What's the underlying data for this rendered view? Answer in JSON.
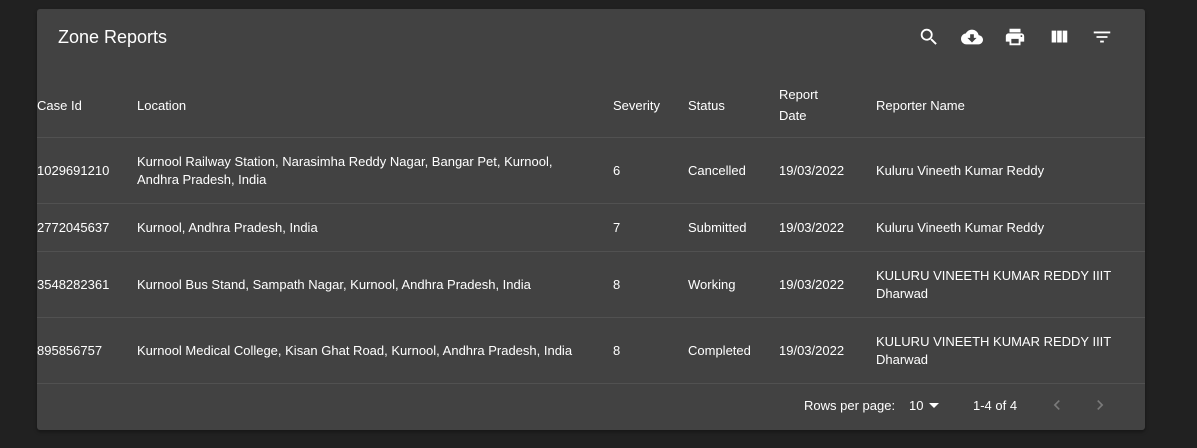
{
  "title": "Zone Reports",
  "toolbar": {
    "icons": [
      "search-icon",
      "cloud-download-icon",
      "print-icon",
      "view-column-icon",
      "filter-list-icon"
    ]
  },
  "columns": {
    "case_id": "Case Id",
    "location": "Location",
    "severity": "Severity",
    "status": "Status",
    "report_date_line1": "Report",
    "report_date_line2": "Date",
    "reporter": "Reporter Name"
  },
  "rows": [
    {
      "case_id": "1029691210",
      "location_line1": "Kurnool Railway Station, Narasimha Reddy Nagar, Bangar Pet, Kurnool,",
      "location_line2": "Andhra Pradesh, India",
      "severity": "6",
      "status": "Cancelled",
      "date": "19/03/2022",
      "reporter_line1": "Kuluru Vineeth Kumar Reddy",
      "reporter_line2": ""
    },
    {
      "case_id": "2772045637",
      "location_line1": "Kurnool, Andhra Pradesh, India",
      "location_line2": "",
      "severity": "7",
      "status": "Submitted",
      "date": "19/03/2022",
      "reporter_line1": "Kuluru Vineeth Kumar Reddy",
      "reporter_line2": ""
    },
    {
      "case_id": "3548282361",
      "location_line1": "Kurnool Bus Stand, Sampath Nagar, Kurnool, Andhra Pradesh, India",
      "location_line2": "",
      "severity": "8",
      "status": "Working",
      "date": "19/03/2022",
      "reporter_line1": "KULURU VINEETH KUMAR REDDY IIIT",
      "reporter_line2": "Dharwad"
    },
    {
      "case_id": "895856757",
      "location_line1": "Kurnool Medical College, Kisan Ghat Road, Kurnool, Andhra Pradesh, India",
      "location_line2": "",
      "severity": "8",
      "status": "Completed",
      "date": "19/03/2022",
      "reporter_line1": "KULURU VINEETH KUMAR REDDY IIIT",
      "reporter_line2": "Dharwad"
    }
  ],
  "pagination": {
    "rows_per_page_label": "Rows per page:",
    "rows_per_page_value": "10",
    "range": "1-4 of 4"
  },
  "colors": {
    "background": "#212121",
    "panel": "#424242",
    "divider": "#515151",
    "text": "#ffffff",
    "disabled": "#7a7a7a"
  }
}
